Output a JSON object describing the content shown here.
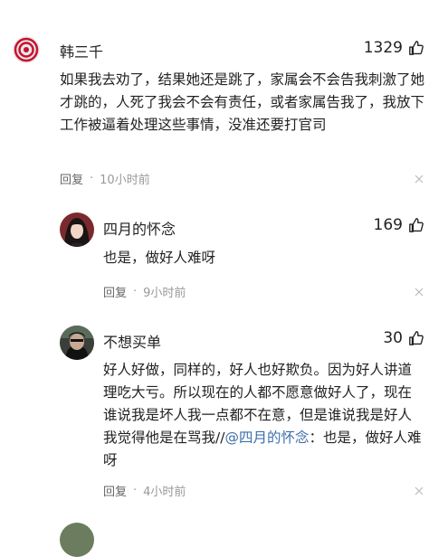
{
  "comments": [
    {
      "user": "韩三千",
      "likes": "1329",
      "body": "如果我去劝了，结果她还是跳了，家属会不会告我刺激了她才跳的，人死了我会不会有责任，或者家属告我了，我放下工作被逼着处理这些事情，没准还要打官司",
      "reply_label": "回复",
      "time": "10小时前"
    },
    {
      "user": "四月的怀念",
      "likes": "169",
      "body": "也是，做好人难呀",
      "reply_label": "回复",
      "time": "9小时前"
    },
    {
      "user": "不想买单",
      "likes": "30",
      "body_pre": "好人好做，同样的，好人也好欺负。因为好人讲道理吃大亏。所以现在的人都不愿意做好人了，现在谁说我是坏人我一点都不在意，但是谁说我是好人我觉得他是在骂我//",
      "mention": "@四月的怀念",
      "body_post": "：也是，做好人难呀",
      "reply_label": "回复",
      "time": "4小时前"
    }
  ],
  "colors": {
    "mention": "#3d6fa8",
    "meta_text": "#666666",
    "time_text": "#999999",
    "avatar1_accent": "#c8102e"
  }
}
